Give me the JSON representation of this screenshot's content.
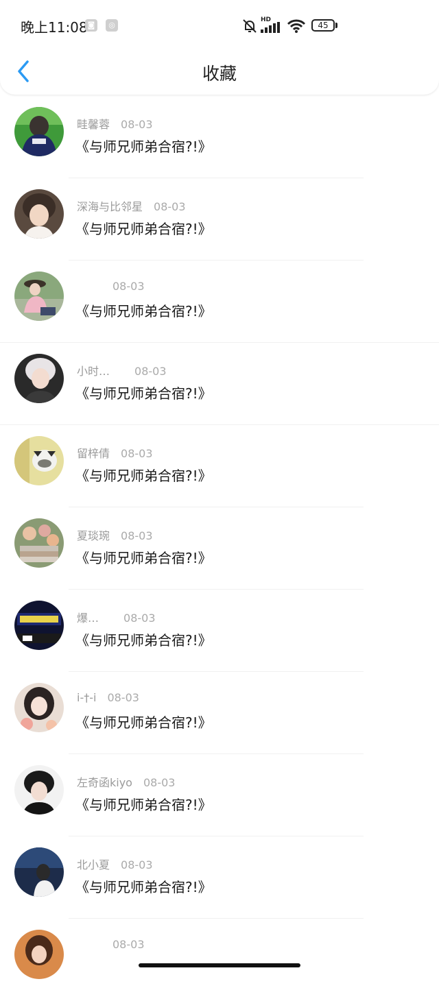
{
  "status_bar": {
    "time": "晚上11:08",
    "battery": "45",
    "network_tag": "HD"
  },
  "header": {
    "title": "收藏",
    "back_icon": "chevron-left-icon",
    "accent": "#2b9af3"
  },
  "items": [
    {
      "name": "畦馨蓉",
      "date": "08-03",
      "title": "《与师兄师弟合宿?!》"
    },
    {
      "name": "深海与比邻星",
      "date": "08-03",
      "title": "《与师兄师弟合宿?!》"
    },
    {
      "name": "",
      "date": "08-03",
      "title": "《与师兄师弟合宿?!》"
    },
    {
      "name": "小时…",
      "date": "08-03",
      "title": "《与师兄师弟合宿?!》"
    },
    {
      "name": "留梓倩",
      "date": "08-03",
      "title": "《与师兄师弟合宿?!》"
    },
    {
      "name": "夏琰琬",
      "date": "08-03",
      "title": "《与师兄师弟合宿?!》"
    },
    {
      "name": "爆…",
      "date": "08-03",
      "title": "《与师兄师弟合宿?!》"
    },
    {
      "name": "i-†-i",
      "date": "08-03",
      "title": "《与师兄师弟合宿?!》"
    },
    {
      "name": "左奇函kiyo",
      "date": "08-03",
      "title": "《与师兄师弟合宿?!》"
    },
    {
      "name": "北小夏",
      "date": "08-03",
      "title": "《与师兄师弟合宿?!》"
    },
    {
      "name": "",
      "date": "08-03",
      "title": ""
    }
  ]
}
